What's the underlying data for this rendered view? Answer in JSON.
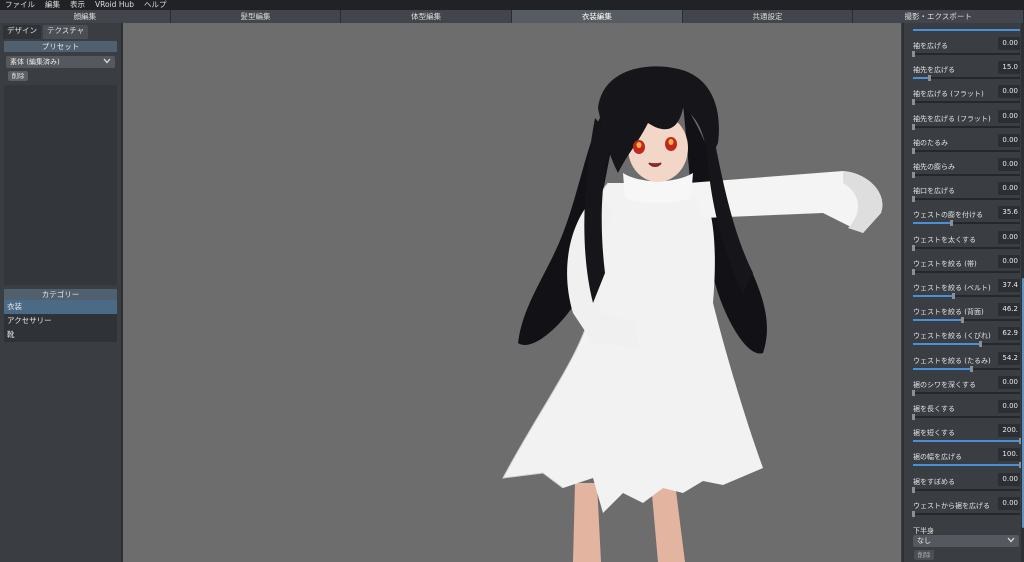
{
  "menu": [
    "ファイル",
    "編集",
    "表示",
    "VRoid Hub",
    "ヘルプ"
  ],
  "tabs": [
    {
      "label": "顔編集",
      "active": false
    },
    {
      "label": "髪型編集",
      "active": false
    },
    {
      "label": "体型編集",
      "active": false
    },
    {
      "label": "衣装編集",
      "active": true
    },
    {
      "label": "共通設定",
      "active": false
    },
    {
      "label": "撮影・エクスポート",
      "active": false
    }
  ],
  "left": {
    "subtabs": [
      "デザイン",
      "テクスチャ"
    ],
    "preset_header": "プリセット",
    "preset_select": "素体 (編集済み)",
    "delete_label": "削除",
    "category_header": "カテゴリー",
    "categories": [
      {
        "label": "衣装",
        "active": true
      },
      {
        "label": "アクセサリー",
        "active": false
      },
      {
        "label": "靴",
        "active": false
      }
    ]
  },
  "right": {
    "params": [
      {
        "label": "袖を広げる",
        "value": "0.00",
        "level": 0.0
      },
      {
        "label": "袖先を広げる",
        "value": "15.0",
        "level": 0.15
      },
      {
        "label": "袖を広げる (フラット)",
        "value": "0.00",
        "level": 0.0
      },
      {
        "label": "袖先を広げる (フラット)",
        "value": "0.00",
        "level": 0.0
      },
      {
        "label": "袖のたるみ",
        "value": "0.00",
        "level": 0.0
      },
      {
        "label": "袖先の膨らみ",
        "value": "0.00",
        "level": 0.0
      },
      {
        "label": "袖口を広げる",
        "value": "0.00",
        "level": 0.0
      },
      {
        "label": "ウェストの膨を付ける",
        "value": "35.6",
        "level": 0.356
      },
      {
        "label": "ウェストを太くする",
        "value": "0.00",
        "level": 0.0
      },
      {
        "label": "ウェストを絞る (帯)",
        "value": "0.00",
        "level": 0.0
      },
      {
        "label": "ウェストを絞る (ベルト)",
        "value": "37.4",
        "level": 0.374
      },
      {
        "label": "ウェストを絞る (背面)",
        "value": "46.2",
        "level": 0.462
      },
      {
        "label": "ウェストを絞る (くびれ)",
        "value": "62.9",
        "level": 0.629
      },
      {
        "label": "ウェストを絞る (たるみ)",
        "value": "54.2",
        "level": 0.542
      },
      {
        "label": "裾のシワを深くする",
        "value": "0.00",
        "level": 0.0
      },
      {
        "label": "裾を長くする",
        "value": "0.00",
        "level": 0.0
      },
      {
        "label": "裾を短くする",
        "value": "200.",
        "level": 1.0
      },
      {
        "label": "裾の幅を広げる",
        "value": "100.",
        "level": 1.0
      },
      {
        "label": "裾をすぼめる",
        "value": "0.00",
        "level": 0.0
      },
      {
        "label": "ウェストから裾を広げる",
        "value": "0.00",
        "level": 0.0
      }
    ],
    "lower_label": "下半身",
    "lower_select": "なし",
    "lower_delete": "削除"
  },
  "colors": {
    "accent": "#4a90d9",
    "viewport": "#6d6d6d",
    "active_category": "#4a6a85"
  }
}
